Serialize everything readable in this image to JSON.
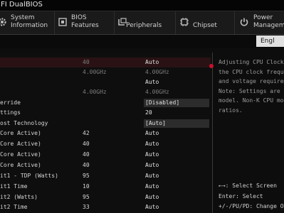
{
  "window": {
    "title": "FI DualBIOS"
  },
  "tabs": [
    {
      "label_line1": "System",
      "label_line2": "Information",
      "icon": "gear-icon"
    },
    {
      "label_line1": "BIOS",
      "label_line2": "Features",
      "icon": "bios-chip-icon"
    },
    {
      "label_line1": "",
      "label_line2": "Peripherals",
      "icon": "peripherals-icon"
    },
    {
      "label_line1": "",
      "label_line2": "Chipset",
      "icon": "chipset-icon"
    },
    {
      "label_line1": "Power",
      "label_line2": "Management",
      "icon": "power-icon"
    }
  ],
  "language": {
    "label": "Engl"
  },
  "settings": {
    "rows": [
      {
        "name": "",
        "current": "40",
        "value": "Auto"
      },
      {
        "name": "",
        "current": "4.00GHz",
        "value": "4.00GHz"
      },
      {
        "name": "",
        "current": "",
        "value": "Auto"
      },
      {
        "name": "",
        "current": "4.00GHz",
        "value": "4.00GHz"
      },
      {
        "name": "erride",
        "current": "",
        "value": "[Disabled]"
      },
      {
        "name": "ttings",
        "current": "",
        "value": "20"
      },
      {
        "name": "ost Technology",
        "current": "",
        "value": "[Auto]"
      },
      {
        "name": "Core Active)",
        "current": "42",
        "value": "Auto"
      },
      {
        "name": "Core Active)",
        "current": "40",
        "value": "Auto"
      },
      {
        "name": "Core Active)",
        "current": "40",
        "value": "Auto"
      },
      {
        "name": "Core Active)",
        "current": "40",
        "value": "Auto"
      },
      {
        "name": "it1 - TDP (Watts)",
        "current": "95",
        "value": "Auto"
      },
      {
        "name": "it1 Time",
        "current": "10",
        "value": "Auto"
      },
      {
        "name": "it2 (Watts)",
        "current": "95",
        "value": "Auto"
      },
      {
        "name": "it2 Time",
        "current": "33",
        "value": "Auto"
      }
    ]
  },
  "help": {
    "lines": [
      "Adjusting CPU Clock",
      "the CPU clock freque",
      "and voltage requirem",
      "Note: Settings are c",
      "model. Non-K CPU mod",
      "ratios."
    ]
  },
  "keys": {
    "lines": [
      "←→: Select Screen",
      "Enter: Select",
      "+/-/PU/PD: Change Op"
    ]
  },
  "colors": {
    "accent": "#c8102e",
    "selected_row": "#2a1214",
    "background": "#0e0e0e"
  }
}
